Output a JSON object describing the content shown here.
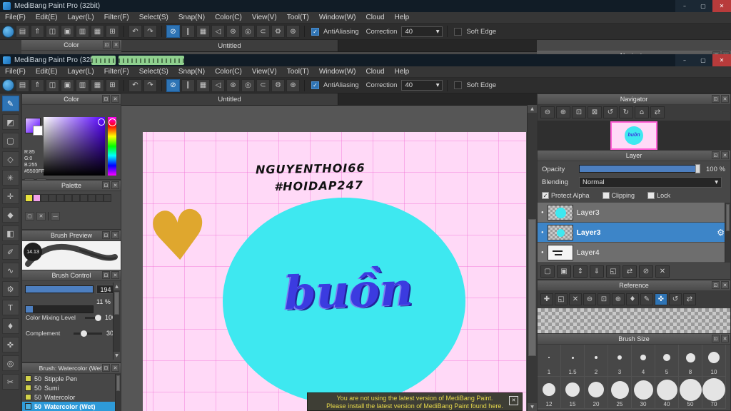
{
  "app": {
    "title": "MediBang Paint Pro (32bit)",
    "menu": [
      "File(F)",
      "Edit(E)",
      "Layer(L)",
      "Filter(F)",
      "Select(S)",
      "Snap(N)",
      "Color(C)",
      "View(V)",
      "Tool(T)",
      "Window(W)",
      "Cloud",
      "Help"
    ],
    "toolbar": {
      "antialiasing": "AntiAliasing",
      "correction": "Correction",
      "correction_value": "40",
      "soft_edge": "Soft Edge"
    }
  },
  "tab": {
    "document": "Untitled"
  },
  "canvas": {
    "text1": "NGUYENTHOI66",
    "text2": "#HOIDAP247",
    "word": "buồn"
  },
  "color_panel": {
    "title": "Color",
    "r": "R:85",
    "g": "G:0",
    "b": "B:255",
    "hex": "#5500FF"
  },
  "palette_panel": {
    "title": "Palette"
  },
  "brush_preview": {
    "title": "Brush Preview",
    "size": "14.13"
  },
  "brush_control": {
    "title": "Brush Control",
    "value1": "194",
    "value2": "11 %",
    "mixing_label": "Color Mixing Level",
    "mixing_value": "100",
    "complement_label": "Complement",
    "complement_value": "30"
  },
  "brush_list": {
    "title": "Brush: Watercolor (Wet)",
    "items": [
      {
        "size": "50",
        "name": "Stipple Pen"
      },
      {
        "size": "50",
        "name": "Sumi"
      },
      {
        "size": "50",
        "name": "Watercolor"
      },
      {
        "size": "50",
        "name": "Watercolor (Wet)"
      }
    ]
  },
  "navigator": {
    "title": "Navigator"
  },
  "layer_panel": {
    "title": "Layer",
    "opacity_label": "Opacity",
    "opacity_value": "100 %",
    "blending_label": "Blending",
    "blending_value": "Normal",
    "protect_alpha": "Protect Alpha",
    "clipping": "Clipping",
    "lock": "Lock",
    "layers": [
      {
        "name": "Layer3"
      },
      {
        "name": "Layer3"
      },
      {
        "name": "Layer4"
      }
    ]
  },
  "reference_panel": {
    "title": "Reference"
  },
  "brush_size": {
    "title": "Brush Size",
    "sizes": [
      "1",
      "1.5",
      "2",
      "3",
      "4",
      "5",
      "8",
      "10",
      "12",
      "15",
      "20",
      "25",
      "30",
      "40",
      "50",
      "70"
    ]
  },
  "notification": {
    "line1": "You are not using the latest version of MediBang Paint.",
    "line2": "Please install the latest version of MediBang Paint found here."
  },
  "colors": {
    "accent_blue": "#2e74b5",
    "selection_blue": "#3d85c8",
    "brush_selected_blue": "#2e9ad8",
    "slider_fill": "#4d7fc0",
    "canvas_pink": "#ffd9f7",
    "grid_pink": "#f064d2",
    "ellipse_cyan": "#3ee8f0",
    "heart_gold": "#dfa72e",
    "word_blue": "#3b3be0",
    "notification_yellow": "#e6d84a",
    "titlebar": "#111c26",
    "close_red": "#b83b3b",
    "highlight_green": "#8fd08f",
    "current_color_hex": "#5500FF"
  },
  "icons": {
    "minimize": "–",
    "maximize": "▢",
    "close": "✕",
    "popout": "⊡",
    "undo": "↶",
    "redo": "↷",
    "check": "✓",
    "arrow_down": "▾",
    "arrow_up_small": "▲",
    "arrow_down_small": "▼",
    "file_save": "▤",
    "file_export": "⇑",
    "file_comment": "◫",
    "file_copy": "▣",
    "file_paste": "▥",
    "view_grid": "▦",
    "view_table": "⊞",
    "snap_off": "⊘",
    "snap_parallel": "∥",
    "snap_grid": "▦",
    "snap_vanish": "◁",
    "snap_radial": "⊛",
    "snap_ellipse": "◎",
    "snap_curve": "⊂",
    "snap_settings": "⚙",
    "snap_move": "⊕",
    "tool_brush": "✎",
    "tool_eraser": "◩",
    "tool_marquee": "▢",
    "tool_lasso": "◇",
    "tool_wand": "✳",
    "tool_move": "✛",
    "tool_bucket": "◆",
    "tool_gradient": "◧",
    "tool_selectpen": "✐",
    "tool_smudge": "∿",
    "tool_wrench": "⚙",
    "tool_text": "T",
    "tool_eyedropper": "♦",
    "tool_hand": "✜",
    "tool_zoom": "◎",
    "tool_slice": "✂",
    "zoom_out": "⊖",
    "zoom_in": "⊕",
    "zoom_fit": "⊡",
    "zoom_actual": "⊠",
    "rotate_ccw": "↺",
    "rotate_cw": "↻",
    "rotate_reset": "⌂",
    "flip": "⇄",
    "layer_new": "▢",
    "layer_dup": "▣",
    "layer_updown": "↕",
    "layer_merge": "⇓",
    "layer_folder": "◱",
    "layer_clear": "⊘",
    "layer_trash": "✕",
    "ref_add": "✚",
    "color_wheel": "◐",
    "color_sliders": "≡",
    "palette_new": "▢",
    "palette_trash": "✕",
    "palette_menu": "—",
    "gear": "⚙",
    "visible_dot": "●",
    "heart": "♥"
  }
}
